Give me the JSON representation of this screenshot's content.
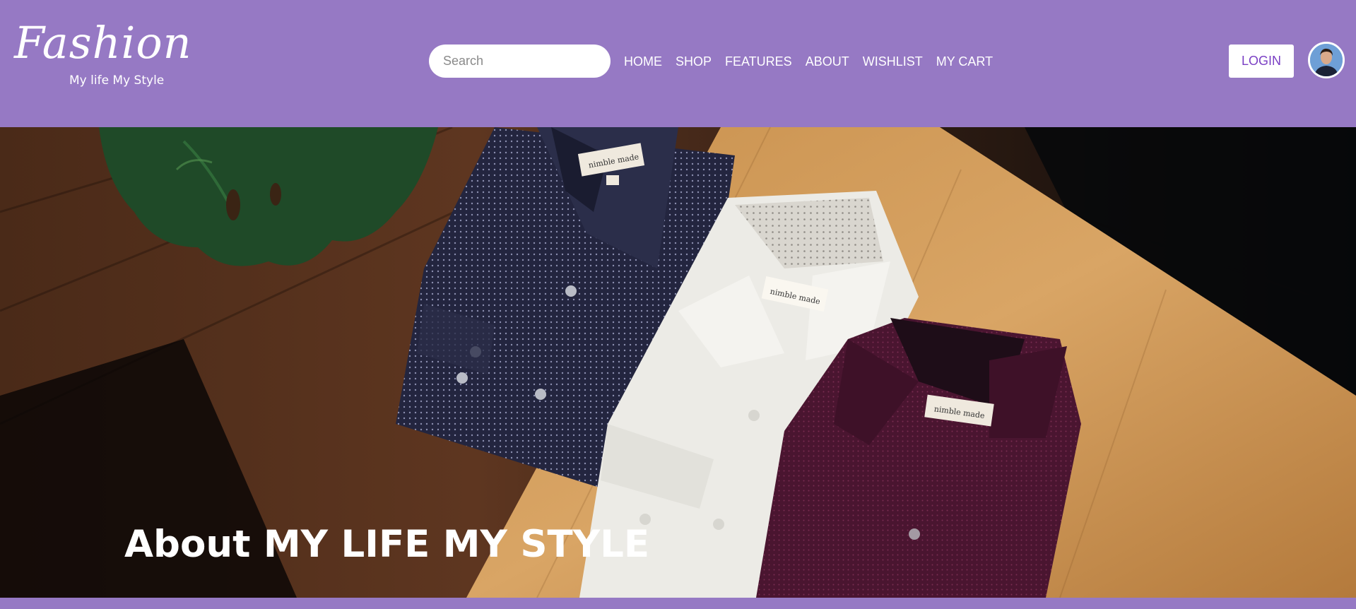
{
  "brand": {
    "name": "Fashion",
    "tagline": "My life My Style"
  },
  "search": {
    "placeholder": "Search"
  },
  "nav": {
    "items": [
      {
        "label": "HOME"
      },
      {
        "label": "SHOP"
      },
      {
        "label": "FEATURES"
      },
      {
        "label": "ABOUT"
      },
      {
        "label": "WISHLIST"
      },
      {
        "label": "MY CART"
      }
    ]
  },
  "header": {
    "login_label": "LOGIN",
    "avatar_icon": "user-avatar"
  },
  "hero": {
    "title": "About MY LIFE MY STYLE",
    "image": "folded dress shirts on wooden table with monstera leaf",
    "label_text": "nimble made",
    "label_size": "N1"
  },
  "colors": {
    "header_bg": "#9679c4",
    "login_text": "#7a3fc4",
    "white": "#ffffff"
  }
}
